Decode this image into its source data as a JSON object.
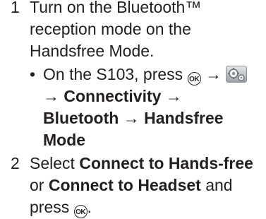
{
  "steps": [
    {
      "number": "1",
      "lines": [
        "Turn on the Bluetooth™",
        "reception mode on the",
        "Handsfree Mode."
      ],
      "bullet": "•",
      "sub": {
        "prefix": "On the S103, press",
        "arrow": "→",
        "connectivity": "Connectivity",
        "bluetooth": "Bluetooth",
        "handsfree_mode": "Handsfree",
        "mode": "Mode"
      }
    },
    {
      "number": "2",
      "select": "Select",
      "option1": "Connect to Hands-free",
      "or": "or",
      "option2": "Connect to Headset",
      "and": "and",
      "press": "press",
      "period": "."
    }
  ],
  "icons": {
    "ok_key": "OK",
    "settings": "settings-icon",
    "settings_color": "#9aa0a6"
  }
}
